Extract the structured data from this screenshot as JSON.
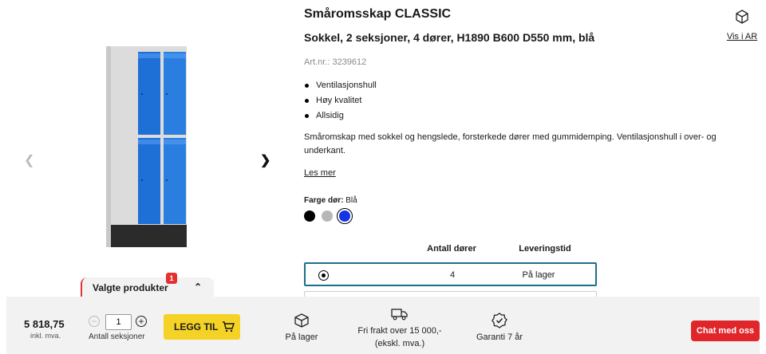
{
  "product": {
    "title": "Småromsskap CLASSIC",
    "subtitle": "Sokkel, 2 seksjoner, 4 dører, H1890 B600 D550 mm, blå",
    "art_nr": "Art.nr.: 3239612",
    "features": [
      "Ventilasjonshull",
      "Høy kvalitet",
      "Allsidig"
    ],
    "description": "Småromskap med sokkel og hengslede, forsterkede dører med gummidemping. Ventilasjonshull i over- og underkant.",
    "read_more": "Les mer",
    "color_label": "Farge dør:",
    "color_value": "Blå",
    "swatches": [
      {
        "name": "black",
        "color": "#000000"
      },
      {
        "name": "grey",
        "color": "#b7b7b7"
      },
      {
        "name": "blue",
        "color": "#1434e6",
        "selected": true
      }
    ]
  },
  "ar": {
    "label": "Vis i AR",
    "icon": "ar-cube-icon"
  },
  "gallery": {
    "prev_icon": "chevron-left-icon",
    "next_icon": "chevron-right-icon"
  },
  "selected_products": {
    "label": "Valgte produkter",
    "count": "1"
  },
  "options_table": {
    "headers": [
      "Antall dører",
      "Leveringstid"
    ],
    "rows": [
      {
        "doors": "4",
        "delivery": "På lager",
        "selected": true
      }
    ]
  },
  "bottom_bar": {
    "price": "5 818,75",
    "price_note": "inkl. mva.",
    "quantity": "1",
    "quantity_label": "Antall seksjoner",
    "buy_label": "LEGG TIL",
    "stock_label": "På lager",
    "shipping_label_1": "Fri frakt over 15 000,-",
    "shipping_label_2": "(ekskl. mva.)",
    "warranty_label": "Garanti 7 år"
  },
  "chat": {
    "label": "Chat med oss"
  },
  "colors": {
    "accent_yellow": "#f5d326",
    "chat_red": "#e0262a",
    "row_border": "#1b6f8a",
    "locker_blue": "#1e6fd6"
  }
}
